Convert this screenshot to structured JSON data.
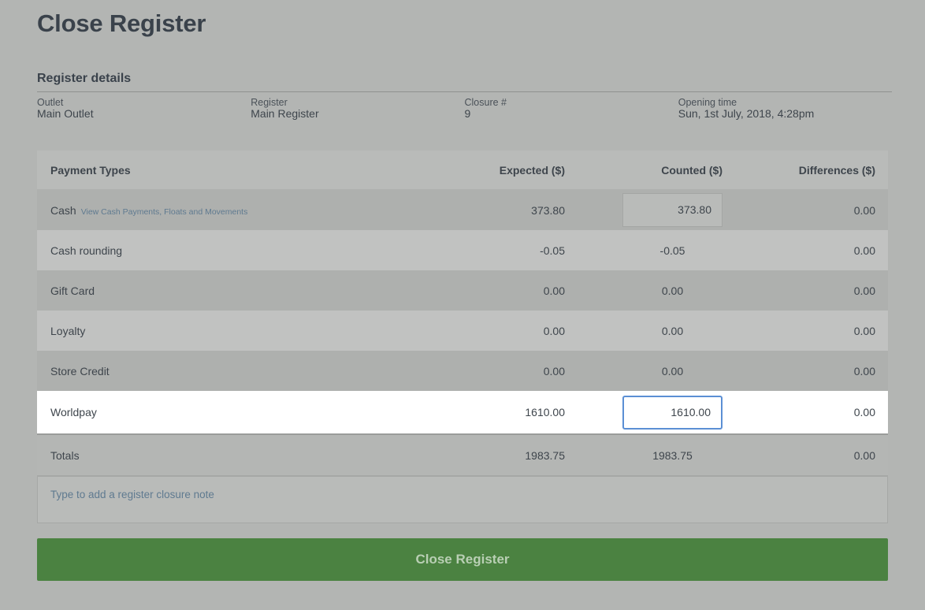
{
  "page": {
    "title": "Close Register"
  },
  "details": {
    "title": "Register details",
    "items": [
      {
        "label": "Outlet",
        "value": "Main Outlet"
      },
      {
        "label": "Register",
        "value": "Main Register"
      },
      {
        "label": "Closure #",
        "value": "9"
      },
      {
        "label": "Opening time",
        "value": "Sun, 1st July, 2018, 4:28pm"
      }
    ]
  },
  "table": {
    "headers": {
      "name": "Payment Types",
      "expected": "Expected ($)",
      "counted": "Counted ($)",
      "differences": "Differences ($)"
    },
    "rows": [
      {
        "name": "Cash",
        "link": "View Cash Payments, Floats and Movements",
        "expected": "373.80",
        "counted": "373.80",
        "differences": "0.00"
      },
      {
        "name": "Cash rounding",
        "expected": "-0.05",
        "counted": "-0.05",
        "differences": "0.00"
      },
      {
        "name": "Gift Card",
        "expected": "0.00",
        "counted": "0.00",
        "differences": "0.00"
      },
      {
        "name": "Loyalty",
        "expected": "0.00",
        "counted": "0.00",
        "differences": "0.00"
      },
      {
        "name": "Store Credit",
        "expected": "0.00",
        "counted": "0.00",
        "differences": "0.00"
      },
      {
        "name": "Worldpay",
        "expected": "1610.00",
        "counted": "1610.00",
        "differences": "0.00"
      }
    ],
    "totals": {
      "name": "Totals",
      "expected": "1983.75",
      "counted": "1983.75",
      "differences": "0.00"
    }
  },
  "note": {
    "placeholder": "Type to add a register closure note"
  },
  "actions": {
    "close_label": "Close Register"
  },
  "colors": {
    "accent": "#4b8241",
    "focus": "#5b8fd4",
    "link": "#5f7a90"
  }
}
